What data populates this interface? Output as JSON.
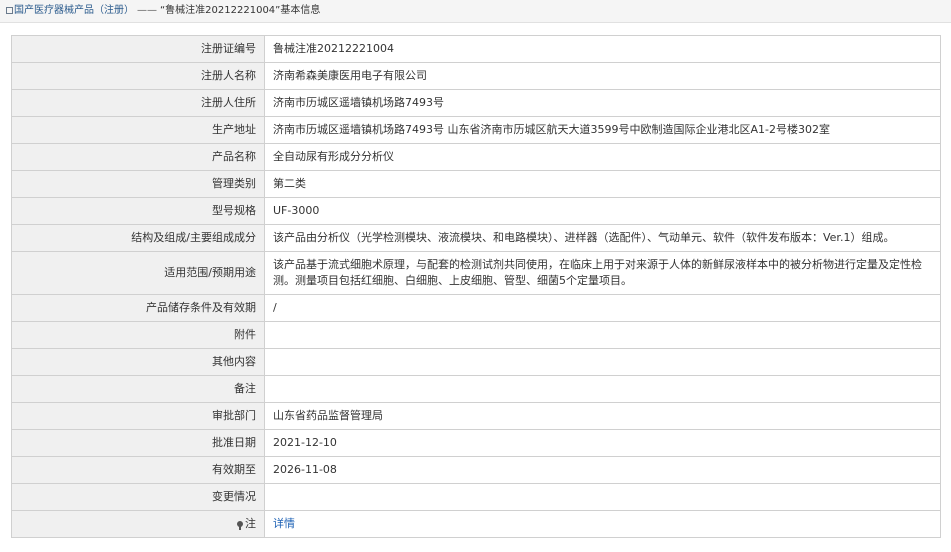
{
  "breadcrumb": {
    "category": "国产医疗器械产品（注册）",
    "separator": "——",
    "record": "“鲁械注准20212221004”",
    "suffix": "基本信息"
  },
  "rows": [
    {
      "label": "注册证编号",
      "value": "鲁械注准20212221004"
    },
    {
      "label": "注册人名称",
      "value": "济南希森美康医用电子有限公司"
    },
    {
      "label": "注册人住所",
      "value": "济南市历城区遥墙镇机场路7493号"
    },
    {
      "label": "生产地址",
      "value": "济南市历城区遥墙镇机场路7493号 山东省济南市历城区航天大道3599号中欧制造国际企业港北区A1-2号楼302室"
    },
    {
      "label": "产品名称",
      "value": "全自动尿有形成分分析仪"
    },
    {
      "label": "管理类别",
      "value": "第二类"
    },
    {
      "label": "型号规格",
      "value": "UF-3000"
    },
    {
      "label": "结构及组成/主要组成成分",
      "value": "该产品由分析仪（光学检测模块、液流模块、和电路模块）、进样器（选配件）、气动单元、软件（软件发布版本：Ver.1）组成。"
    },
    {
      "label": "适用范围/预期用途",
      "value": "该产品基于流式细胞术原理，与配套的检测试剂共同使用，在临床上用于对来源于人体的新鲜尿液样本中的被分析物进行定量及定性检测。测量项目包括红细胞、白细胞、上皮细胞、管型、细菌5个定量项目。"
    },
    {
      "label": "产品储存条件及有效期",
      "value": "/"
    },
    {
      "label": "附件",
      "value": ""
    },
    {
      "label": "其他内容",
      "value": ""
    },
    {
      "label": "备注",
      "value": ""
    },
    {
      "label": "审批部门",
      "value": "山东省药品监督管理局"
    },
    {
      "label": "批准日期",
      "value": "2021-12-10"
    },
    {
      "label": "有效期至",
      "value": "2026-11-08"
    },
    {
      "label": "变更情况",
      "value": ""
    },
    {
      "label": "注",
      "value": "详情"
    }
  ]
}
